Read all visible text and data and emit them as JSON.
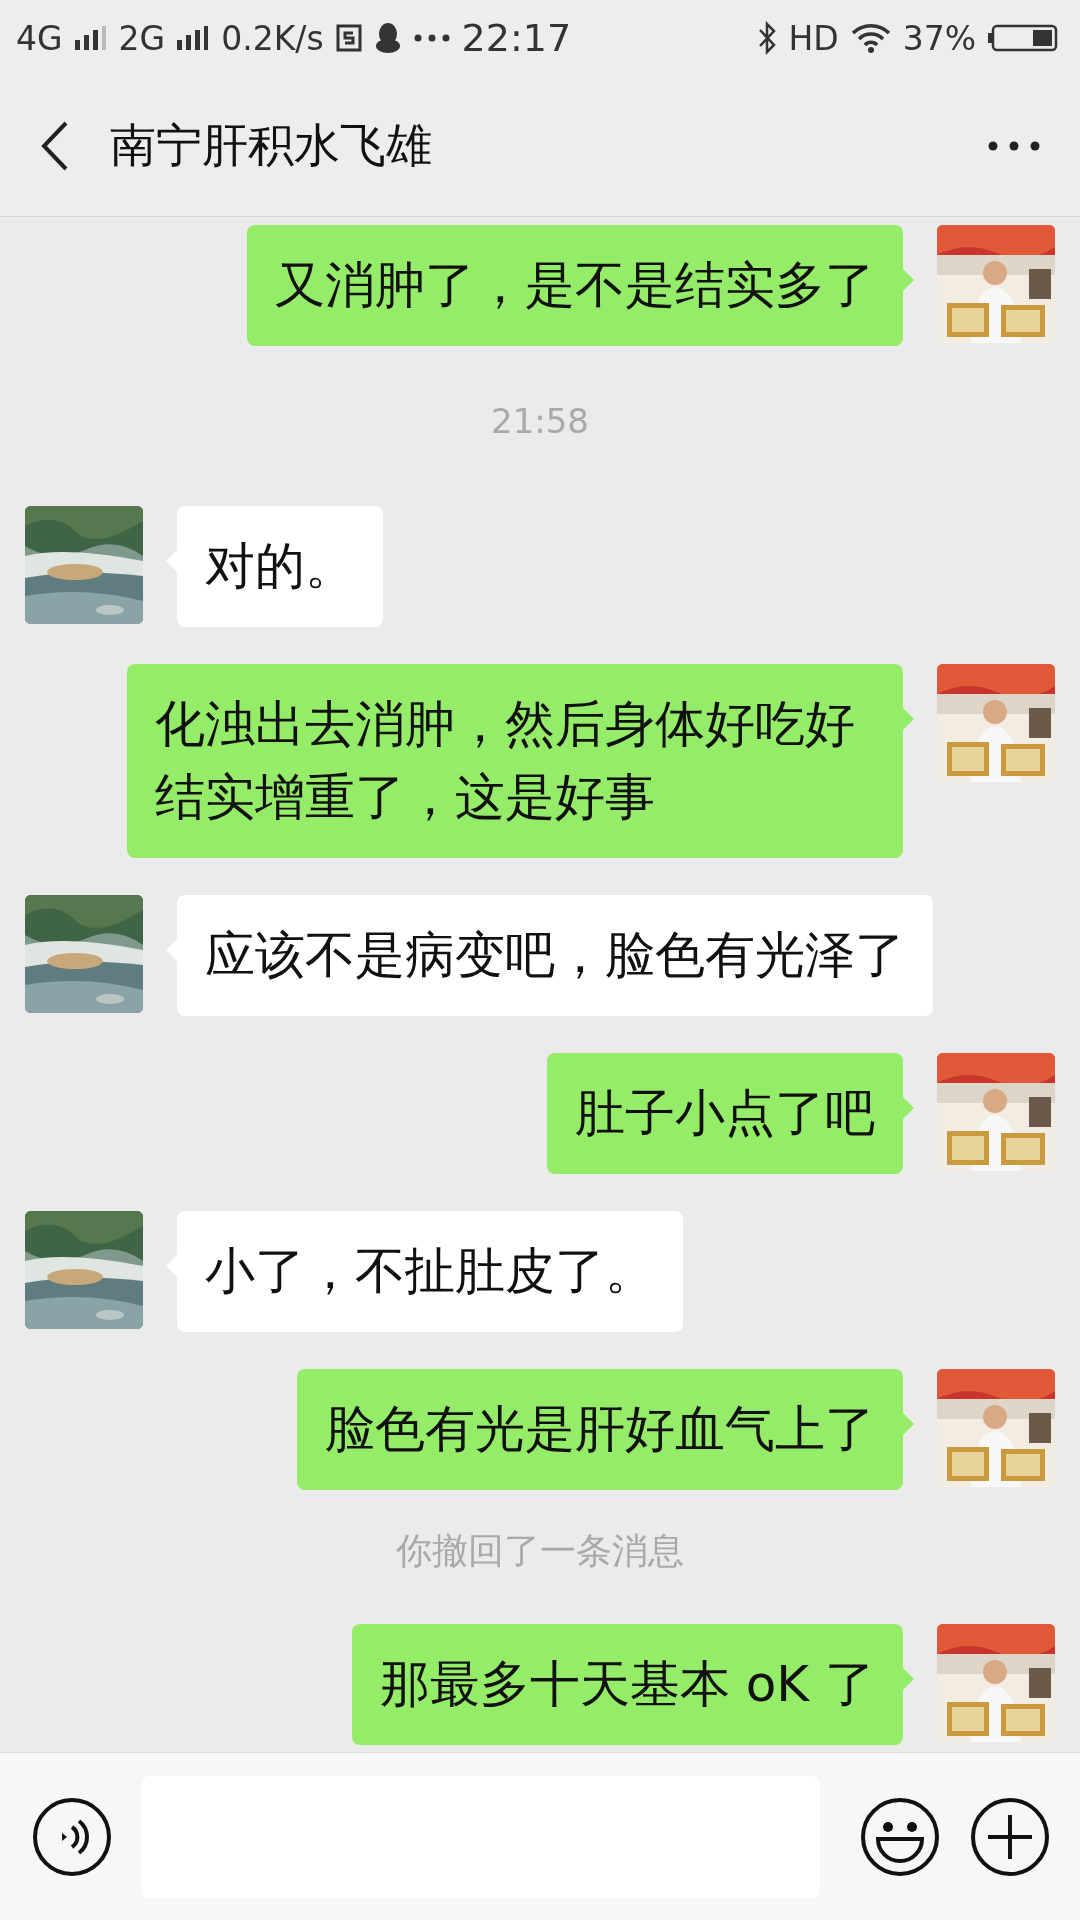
{
  "status_bar": {
    "network_1": "4G",
    "network_2": "2G",
    "speed": "0.2K/s",
    "time": "22:17",
    "hd": "HD",
    "battery": "37%"
  },
  "header": {
    "title": "南宁肝积水飞雄"
  },
  "messages": [
    {
      "kind": "outgoing",
      "text": "又消肿了，是不是结实多了"
    },
    {
      "kind": "time",
      "text": "21:58"
    },
    {
      "kind": "incoming",
      "text": "对的。"
    },
    {
      "kind": "outgoing",
      "text": "化浊出去消肿，然后身体好吃好结实增重了，这是好事"
    },
    {
      "kind": "incoming",
      "text": "应该不是病变吧，脸色有光泽了"
    },
    {
      "kind": "outgoing",
      "text": "肚子小点了吧"
    },
    {
      "kind": "incoming",
      "text": "小了，不扯肚皮了。"
    },
    {
      "kind": "outgoing",
      "text": "脸色有光是肝好血气上了"
    },
    {
      "kind": "system",
      "text": "你撤回了一条消息"
    },
    {
      "kind": "outgoing",
      "text": "那最多十天基本 oK 了"
    }
  ]
}
